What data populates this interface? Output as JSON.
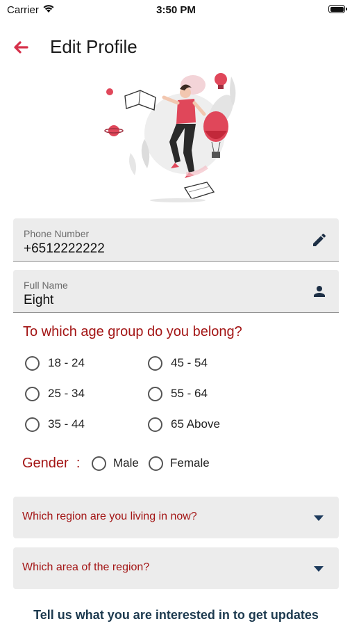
{
  "status_bar": {
    "carrier": "Carrier",
    "time": "3:50 PM"
  },
  "header": {
    "title": "Edit Profile"
  },
  "phone_field": {
    "label": "Phone Number",
    "value": "+6512222222"
  },
  "name_field": {
    "label": "Full Name",
    "value": "Eight"
  },
  "age_question": "To which age group do you belong?",
  "age_options": [
    "18 - 24",
    "45 - 54",
    "25 - 34",
    "55 - 64",
    "35 - 44",
    "65 Above"
  ],
  "gender": {
    "label": "Gender  :",
    "options": [
      "Male",
      "Female"
    ]
  },
  "region_dropdown": {
    "placeholder": "Which region are you living in now?"
  },
  "area_dropdown": {
    "placeholder": "Which area of the region?"
  },
  "footer": {
    "text": "Tell us what you are interested in to get updates"
  },
  "colors": {
    "accent": "#a31515",
    "back_arrow": "#d6304a",
    "footer_text": "#1d3a4f",
    "field_bg": "#ececec"
  },
  "icons": {
    "back": "arrow-left-icon",
    "phone": "pencil-icon",
    "name": "person-icon",
    "dropdown": "caret-down-icon"
  }
}
